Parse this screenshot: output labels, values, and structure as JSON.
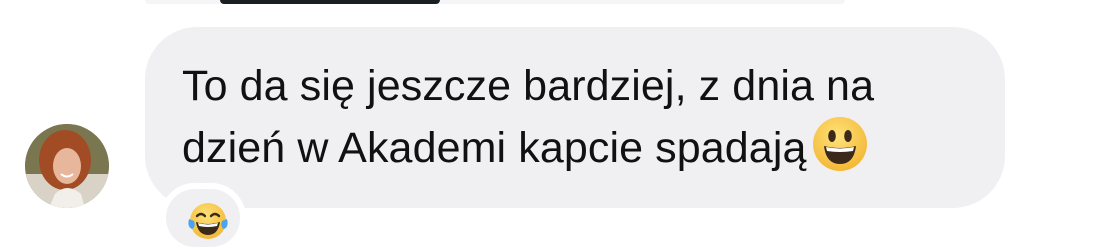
{
  "message": {
    "line1": "To da się jeszcze bardziej, z dnia na",
    "line2": "dzień w Akademi kapcie spadają",
    "inline_emoji": "smiley-icon"
  },
  "reaction": {
    "emoji": "tears-of-joy-icon"
  },
  "avatar": {
    "description_icon": "avatar"
  },
  "colors": {
    "bubble": "#f0f0f3",
    "text": "#111111",
    "emoji_yellow": "#f7c948"
  }
}
